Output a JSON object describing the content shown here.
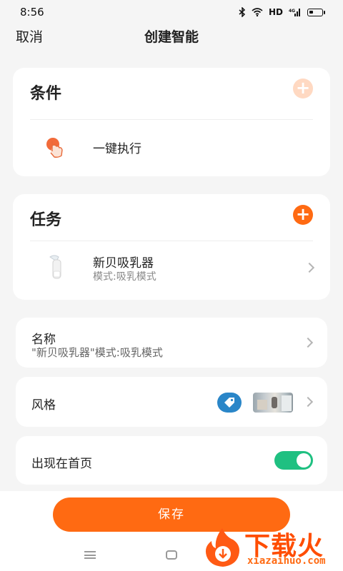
{
  "status": {
    "time": "8:56",
    "network": "HD",
    "signal": "4G"
  },
  "header": {
    "cancel": "取消",
    "title": "创建智能"
  },
  "conditions": {
    "title": "条件",
    "item": {
      "name": "一键执行"
    }
  },
  "tasks": {
    "title": "任务",
    "item": {
      "name": "新贝吸乳器",
      "sub": "模式:吸乳模式"
    }
  },
  "settings": {
    "name": {
      "label": "名称",
      "value": "\"新贝吸乳器\"模式:吸乳模式"
    },
    "style": {
      "label": "风格"
    },
    "homepage": {
      "label": "出现在首页",
      "enabled": true
    }
  },
  "save_label": "保存",
  "watermark": {
    "text": "下载火",
    "url": "xiazaihuo.com"
  },
  "colors": {
    "accent": "#ff6a12",
    "accent_light": "#ffd9c2",
    "toggle_on": "#1fc081",
    "tag_blue": "#2a86c8"
  }
}
